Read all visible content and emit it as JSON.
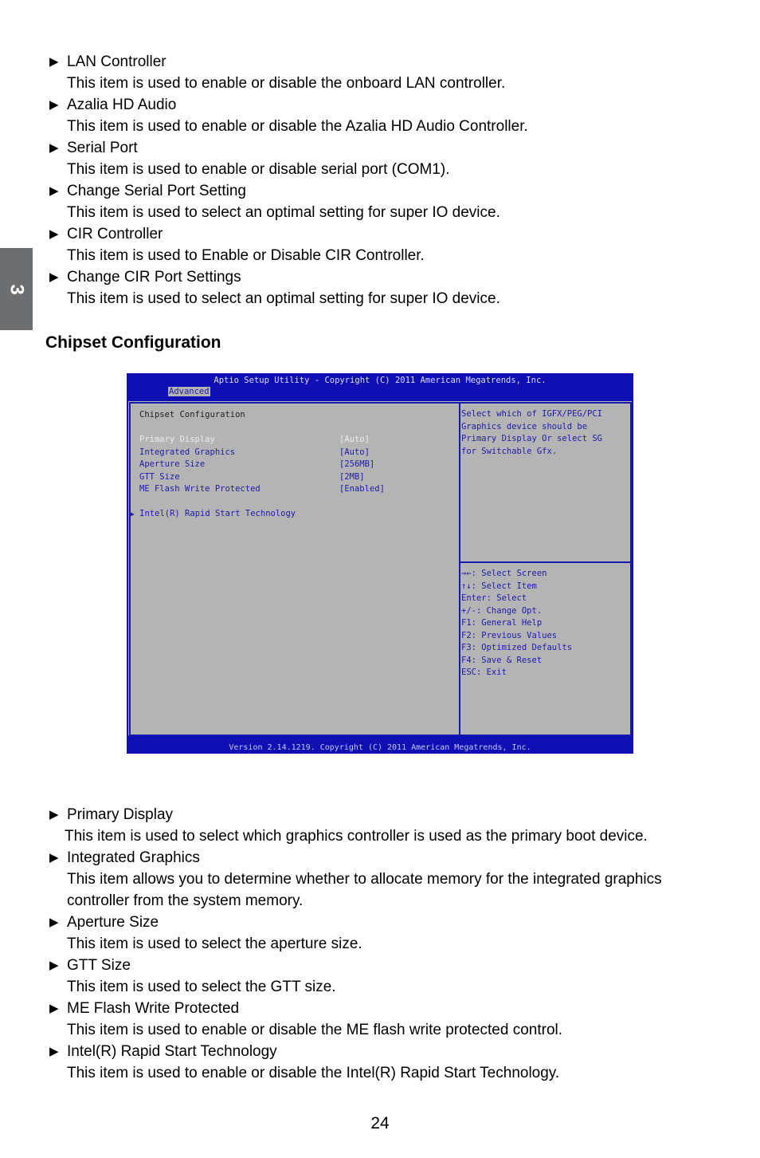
{
  "side_tab": "3",
  "top_items": [
    {
      "title": "LAN Controller",
      "desc": "This item is used to enable or disable the onboard LAN controller."
    },
    {
      "title": "Azalia HD Audio",
      "desc": "This item is used to enable or disable the Azalia HD Audio Controller."
    },
    {
      "title": "Serial Port",
      "desc": "This item is used to enable or disable serial port (COM1)."
    },
    {
      "title": "Change Serial Port Setting",
      "desc": "This item is used to select an optimal setting for super IO device."
    },
    {
      "title": "CIR Controller",
      "desc": "This item is used to Enable or Disable CIR Controller."
    },
    {
      "title": "Change CIR Port Settings",
      "desc": "This item is used to select an optimal setting for super IO device."
    }
  ],
  "section_title": "Chipset Configuration",
  "bios": {
    "title": "Aptio Setup Utility - Copyright (C) 2011 American Megatrends, Inc.",
    "tab": "Advanced",
    "heading": "Chipset Configuration",
    "options": [
      {
        "label": "Primary Display",
        "value": "[Auto]"
      },
      {
        "label": "Integrated Graphics",
        "value": "[Auto]"
      },
      {
        "label": "Aperture Size",
        "value": "[256MB]"
      },
      {
        "label": "GTT Size",
        "value": "[2MB]"
      },
      {
        "label": "ME Flash Write Protected",
        "value": "[Enabled]"
      }
    ],
    "submenu": "Intel(R) Rapid Start Technology",
    "help": [
      "Select which of IGFX/PEG/PCI",
      "Graphics device should be",
      "Primary Display Or select SG",
      "for Switchable Gfx."
    ],
    "keys": [
      "→←: Select Screen",
      "↑↓: Select Item",
      "Enter: Select",
      "+/-: Change Opt.",
      "F1: General Help",
      "F2: Previous Values",
      "F3: Optimized Defaults",
      "F4: Save & Reset",
      "ESC: Exit"
    ],
    "footer": "Version 2.14.1219. Copyright (C) 2011 American Megatrends, Inc."
  },
  "bottom_items": [
    {
      "title": "Primary Display",
      "desc": "This item is used to select which graphics controller is used as the primary boot device."
    },
    {
      "title": "Integrated Graphics",
      "desc": "This item allows you to determine whether to allocate memory for the integrated graphics controller from the system memory."
    },
    {
      "title": "Aperture Size",
      "desc": "This item is used to select the aperture size."
    },
    {
      "title": "GTT Size",
      "desc": "This item is used to select the GTT size."
    },
    {
      "title": "ME Flash Write Protected",
      "desc": "This item is used to enable or disable the ME flash write protected control."
    },
    {
      "title": "Intel(R) Rapid Start Technology",
      "desc": "This item is used to enable or disable the Intel(R) Rapid Start Technology."
    }
  ],
  "page_number": "24"
}
